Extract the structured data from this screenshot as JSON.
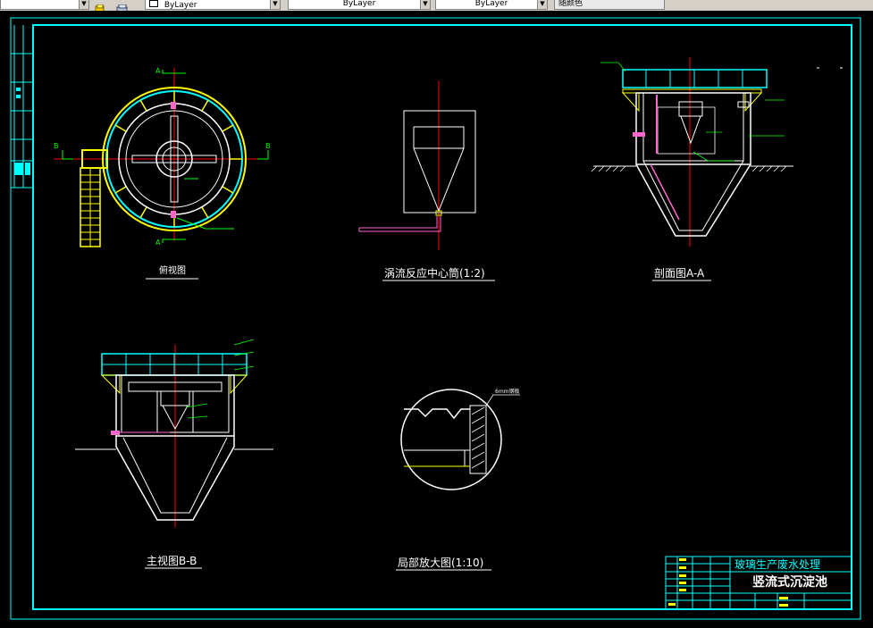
{
  "toolbar": {
    "color_value": "ByLayer",
    "linetype_value": "ByLayer",
    "lineweight_value": "ByLayer",
    "plotstyle_value": "随颜色"
  },
  "drawing": {
    "views": {
      "plan": "俯视图",
      "center_tube": "涡流反应中心筒(1:2)",
      "section_aa": "剖面图A-A",
      "front_bb": "主视图B-B",
      "detail": "局部放大图(1:10)"
    },
    "section_marks": {
      "a": "A",
      "b": "B"
    },
    "detail_note": "6mm钢板",
    "title_block": {
      "project": "玻璃生产废水处理",
      "drawing_name": "竖流式沉淀池"
    }
  },
  "colors": {
    "background": "#000000",
    "frame": "#00ffff",
    "outline": "#ffffff",
    "centerline": "#ff0000",
    "accent": "#ffff00",
    "pipe": "#ff66cc",
    "note": "#00ff00"
  }
}
